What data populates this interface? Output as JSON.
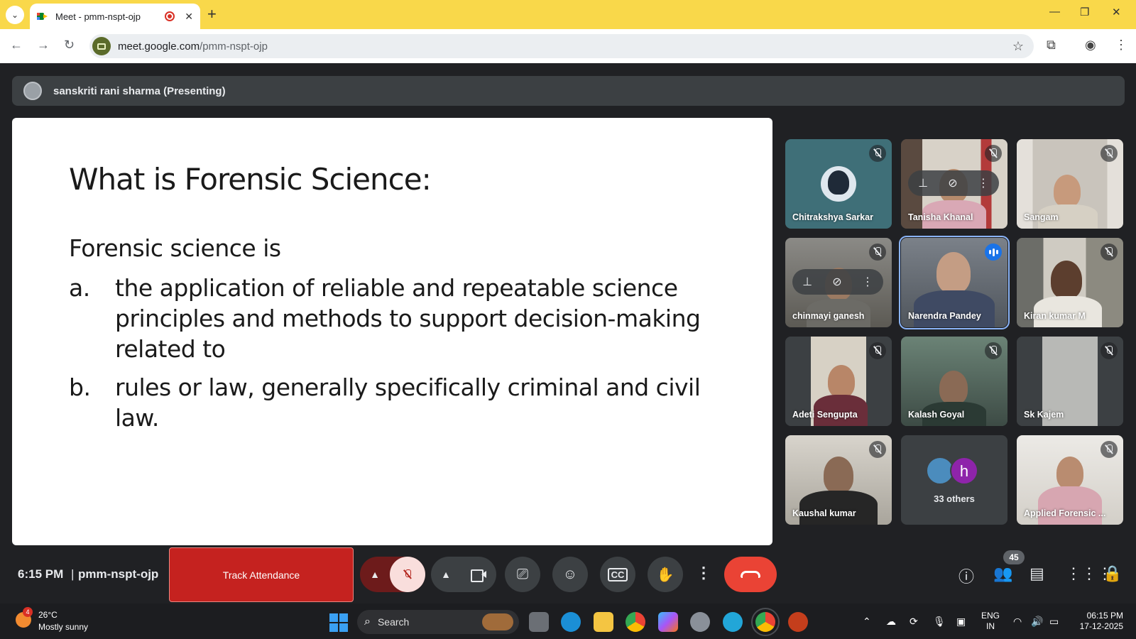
{
  "browser": {
    "tab_title": "Meet - pmm-nspt-ojp",
    "url_host": "meet.google.com",
    "url_path": "/pmm-nspt-ojp",
    "tab_close": "✕",
    "new_tab": "+",
    "minimize": "—",
    "restore": "❐",
    "close": "✕"
  },
  "meet": {
    "presenting_label": "sanskriti rani sharma (Presenting)",
    "slide": {
      "title": "What is Forensic Science:",
      "intro": "Forensic science is",
      "items": [
        {
          "marker": "a.",
          "text": "the application of reliable and repeatable science principles and methods to support decision-making related to"
        },
        {
          "marker": "b.",
          "text": "rules or law, generally specifically criminal and civil law."
        }
      ]
    },
    "participants": [
      {
        "name": "Chitrakshya Sarkar",
        "muted": true
      },
      {
        "name": "Tanisha Khanal",
        "muted": true
      },
      {
        "name": "Sangam",
        "muted": true
      },
      {
        "name": "chinmayi ganesh",
        "muted": true
      },
      {
        "name": "Narendra Pandey",
        "muted": false,
        "speaking": true
      },
      {
        "name": "Kiran kumar M",
        "muted": true
      },
      {
        "name": "Adeti Sengupta",
        "muted": true
      },
      {
        "name": "Kalash Goyal",
        "muted": true
      },
      {
        "name": "Sk Kajem",
        "muted": true
      },
      {
        "name": "Kaushal kumar",
        "muted": true
      },
      {
        "name": "33 others",
        "avatar_letter": "h"
      },
      {
        "name": "Applied Forensic ...",
        "muted": true
      }
    ],
    "controls": {
      "time": "6:15 PM",
      "separator": "|",
      "meeting_code": "pmm-nspt-ojp",
      "track_attendance": "Track Attendance",
      "participant_count": "45"
    }
  },
  "taskbar": {
    "weather_badge": "4",
    "temperature": "26°C",
    "weather": "Mostly sunny",
    "search_label": "Search",
    "lang_top": "ENG",
    "lang_bottom": "IN",
    "time": "06:15 PM",
    "date": "17-12-2025"
  }
}
